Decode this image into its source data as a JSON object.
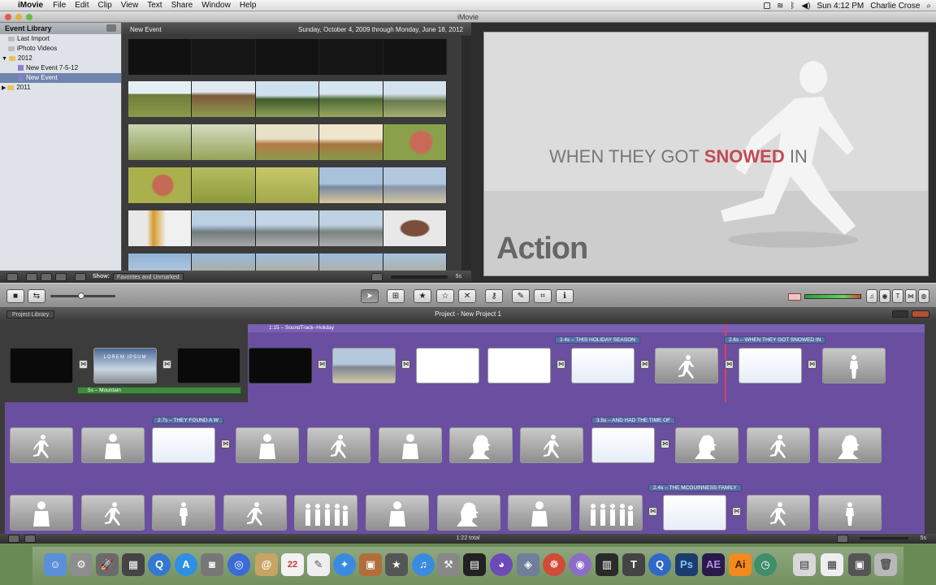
{
  "menubar": {
    "app_name": "iMovie",
    "menus": [
      "File",
      "Edit",
      "Clip",
      "View",
      "Text",
      "Share",
      "Window",
      "Help"
    ],
    "clock": "Sun 4:12 PM",
    "user": "Charlie Crose"
  },
  "window": {
    "title": "iMovie"
  },
  "event_library": {
    "title": "Event Library",
    "items": [
      {
        "label": "Last Import"
      },
      {
        "label": "iPhoto Videos"
      },
      {
        "label": "2012"
      },
      {
        "label": "New Event 7-5-12"
      },
      {
        "label": "New Event"
      },
      {
        "label": "2011"
      }
    ]
  },
  "event_browser": {
    "title": "New Event",
    "date_range": "Sunday, October 4, 2009 through Monday, June 18, 2012",
    "show_label": "Show:",
    "show_value": "Favorites and Unmarked",
    "duration": "5s"
  },
  "viewer": {
    "title_text_a": "WHEN THEY GOT ",
    "title_text_b": "SNOWED",
    "title_text_c": " IN",
    "action_text": "Action"
  },
  "project": {
    "library_button": "Project Library",
    "title": "Project - New Project 1",
    "soundtrack": "1:15 – SoundTrack–Holiday",
    "mountain_clip": "5s – Mountain",
    "lorem": "LOREM IPSUM",
    "title_labels": [
      "2.4s – THIS HOLIDAY SEASON",
      "2.6s – WHEN THEY GOT SNOWED IN",
      "2.7s – THEY FOUND A W",
      "3.5s – AND HAD THE TIME OF",
      "2.4s – THE MCGUINNESS FAMILY"
    ],
    "total": "1:22 total",
    "zoom": "5s"
  },
  "dock": {
    "apps": [
      "Finder",
      "System Preferences",
      "Launchpad",
      "Activity Monitor",
      "QuickTime",
      "App Store",
      "Photo Booth",
      "iTunes DVD",
      "Contacts",
      "Calendar",
      "TextEdit",
      "Safari",
      "Preview",
      "iMovie",
      "iTunes",
      "Xcode",
      "Final Cut",
      "Color",
      "Motion",
      "Pages",
      "Keynote",
      "Photoshop",
      "After Effects",
      "Illustrator",
      "Time Machine",
      "Trash"
    ],
    "ps": "Ps",
    "ae": "AE",
    "ai": "Ai"
  }
}
